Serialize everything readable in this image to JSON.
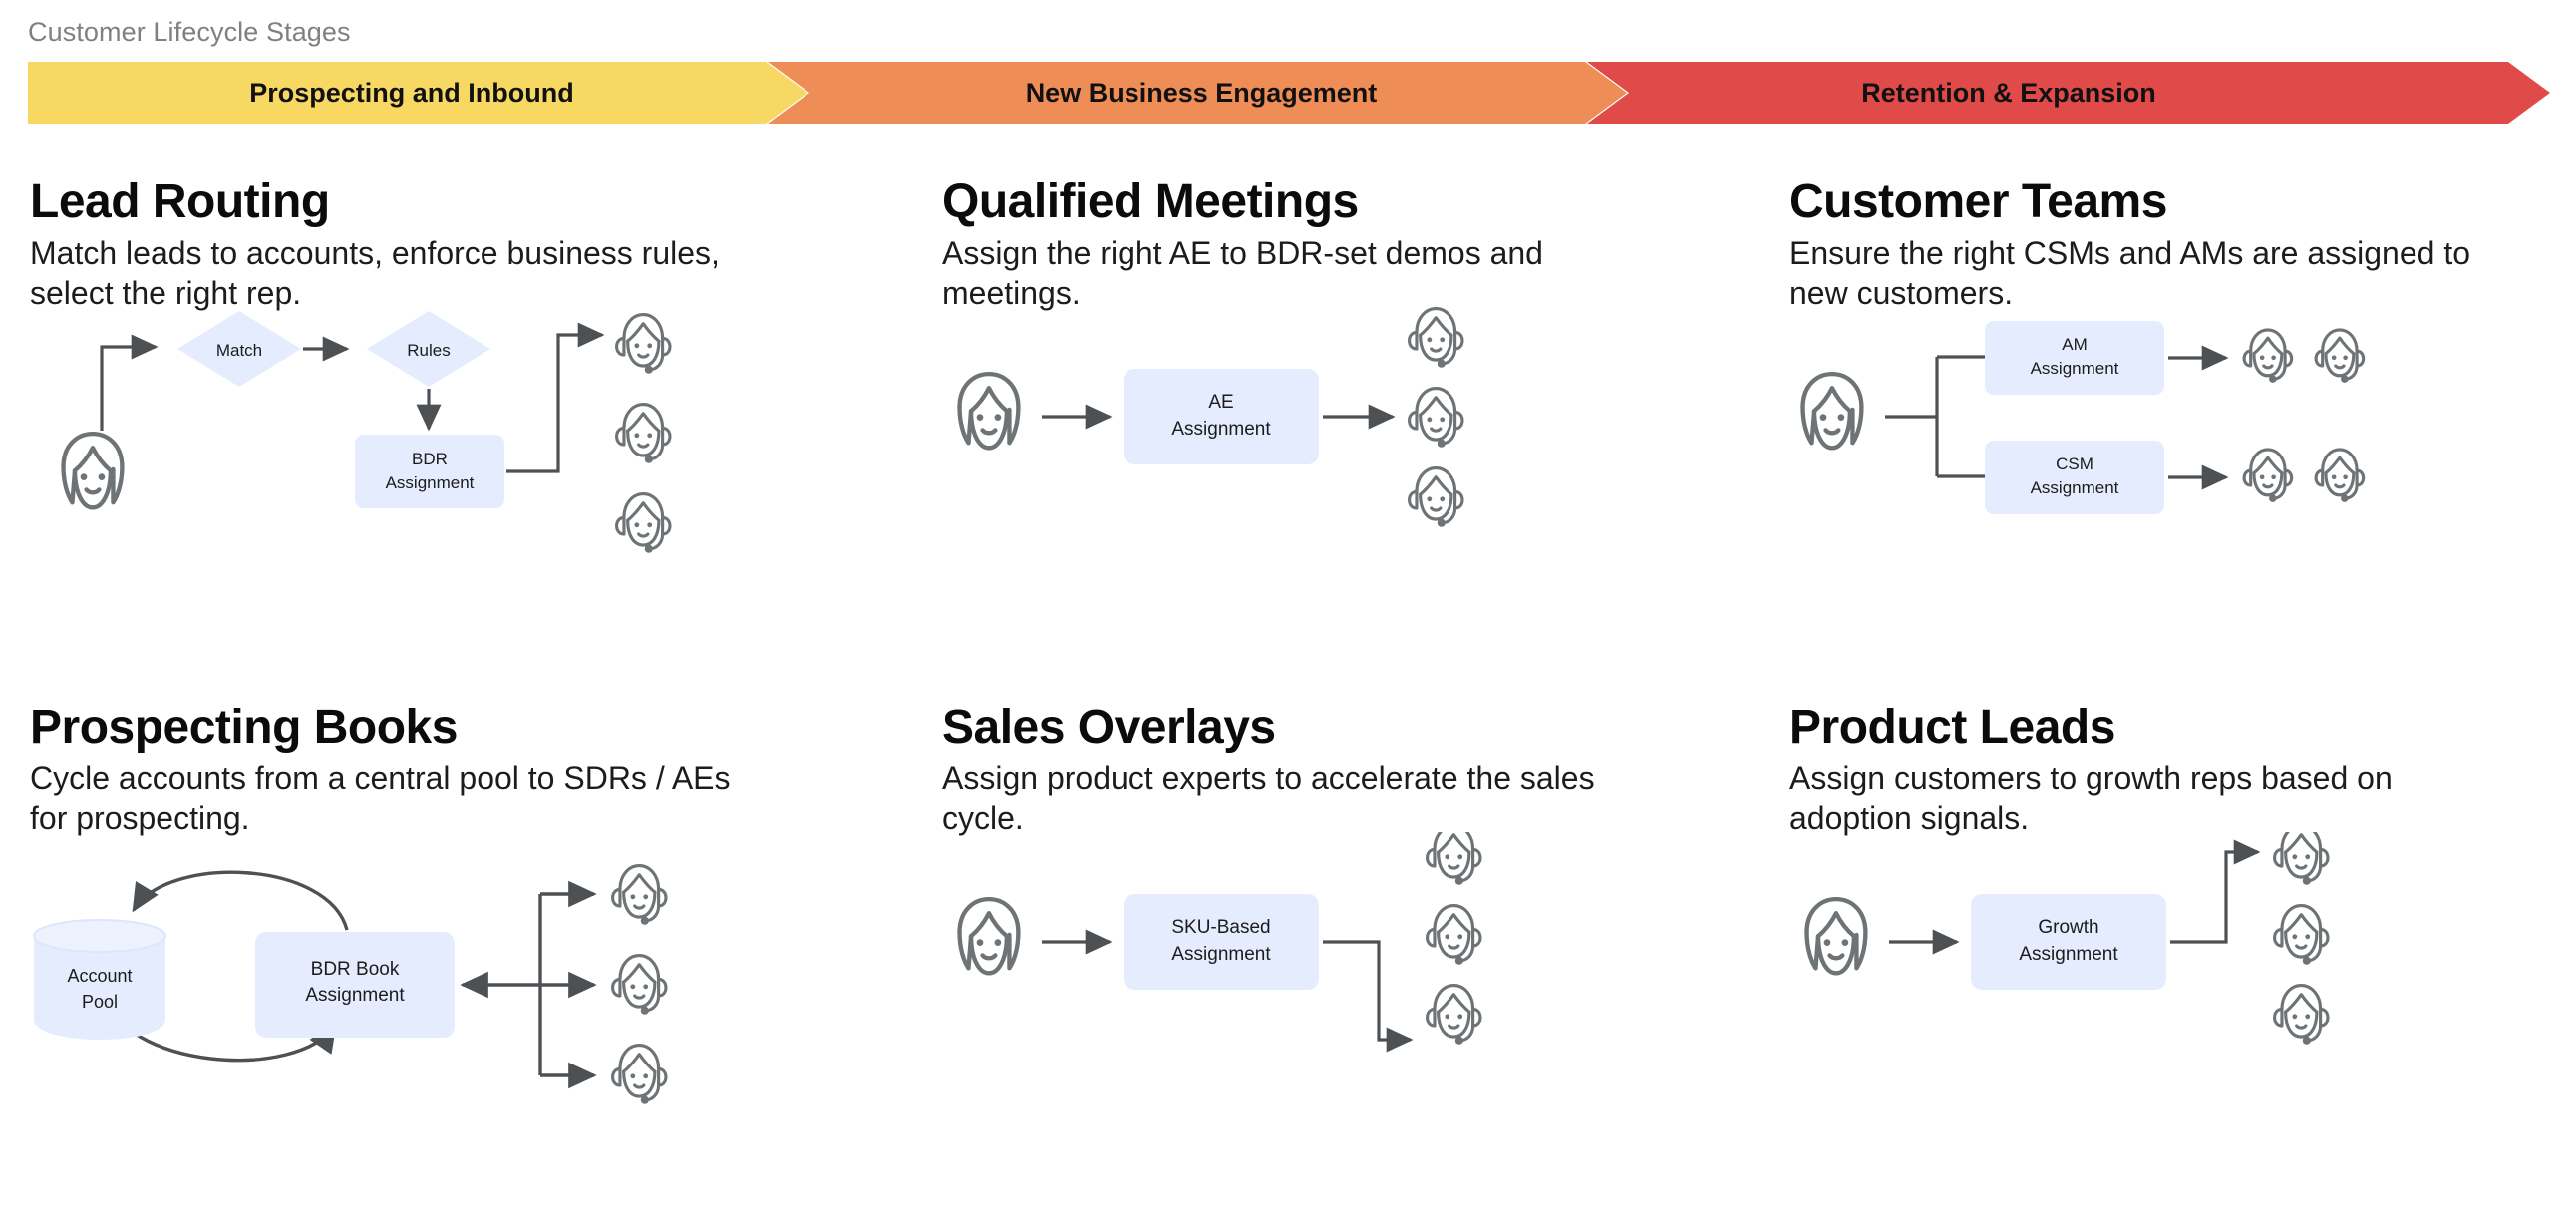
{
  "header": {
    "label": "Customer Lifecycle Stages",
    "stages": [
      {
        "label": "Prospecting and Inbound",
        "color": "#f7d862"
      },
      {
        "label": "New Business Engagement",
        "color": "#ee8d55"
      },
      {
        "label": "Retention & Expansion",
        "color": "#e04a49"
      }
    ]
  },
  "palette": {
    "node_fill": "#e5ecfd",
    "line": "#4d5154",
    "icon_stroke": "#6e7376",
    "node_text": "#1c1c1c",
    "title_text": "#0b0b0b",
    "label_text": "#808080"
  },
  "cards": [
    {
      "title": "Lead Routing",
      "desc": "Match leads to accounts, enforce business rules, select the right rep.",
      "nodes": {
        "match": "Match",
        "rules": "Rules",
        "bdr_assignment_l1": "BDR",
        "bdr_assignment_l2": "Assignment"
      },
      "person_icon": "person-face-icon",
      "agent_icon": "headset-agent-icon",
      "agent_count": 3
    },
    {
      "title": "Qualified Meetings",
      "desc": "Assign the right AE to BDR-set demos and meetings.",
      "nodes": {
        "ae_assignment_l1": "AE",
        "ae_assignment_l2": "Assignment"
      },
      "person_icon": "person-face-icon",
      "agent_icon": "headset-agent-icon",
      "agent_count": 3
    },
    {
      "title": "Customer Teams",
      "desc": "Ensure the right CSMs and AMs are assigned to new customers.",
      "nodes": {
        "am_assignment_l1": "AM",
        "am_assignment_l2": "Assignment",
        "csm_assignment_l1": "CSM",
        "csm_assignment_l2": "Assignment"
      },
      "person_icon": "person-face-icon",
      "agent_icon": "headset-agent-icon",
      "agent_count": 4
    },
    {
      "title": "Prospecting Books",
      "desc": "Cycle accounts from a central pool to SDRs / AEs for prospecting.",
      "nodes": {
        "account_pool_l1": "Account",
        "account_pool_l2": "Pool",
        "bdr_book_l1": "BDR Book",
        "bdr_book_l2": "Assignment"
      },
      "cylinder_icon": "database-cylinder-icon",
      "agent_icon": "headset-agent-icon",
      "agent_count": 3
    },
    {
      "title": "Sales Overlays",
      "desc": "Assign product experts to accelerate the sales cycle.",
      "nodes": {
        "sku_assignment_l1": "SKU-Based",
        "sku_assignment_l2": "Assignment"
      },
      "person_icon": "person-face-icon",
      "agent_icon": "headset-agent-icon",
      "agent_count": 3
    },
    {
      "title": "Product Leads",
      "desc": "Assign customers to growth reps based on adoption signals.",
      "nodes": {
        "growth_assignment_l1": "Growth",
        "growth_assignment_l2": "Assignment"
      },
      "person_icon": "person-face-icon",
      "agent_icon": "headset-agent-icon",
      "agent_count": 3
    }
  ]
}
